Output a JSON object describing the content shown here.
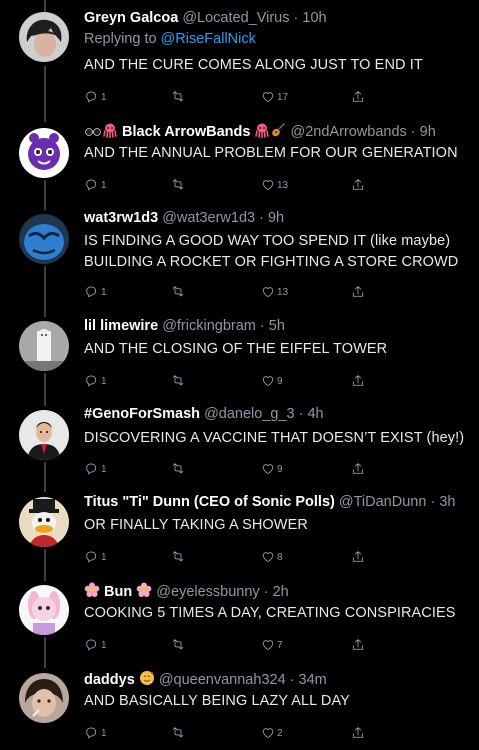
{
  "colors": {
    "background": "#000000",
    "text": "#e7e9ea",
    "muted": "#8b98a5",
    "link": "#1da1f2"
  },
  "tweets": [
    {
      "name": "Greyn Galcoa",
      "handle": "@Located_Virus",
      "time": "10h",
      "replying_prefix": "Replying to ",
      "replying_to": "@RiseFallNick",
      "lines": [
        "AND THE CURE COMES ALONG JUST TO END IT"
      ],
      "replies": "1",
      "retweets": "",
      "likes": "17",
      "avatar": "dark-hair-photo"
    },
    {
      "name": "Black ArrowBands",
      "handle": "@2ndArrowbands",
      "time": "9h",
      "lines": [
        "AND THE ANNUAL PROBLEM FOR OUR GENERATION"
      ],
      "replies": "1",
      "retweets": "",
      "likes": "13",
      "avatar": "purple-cartoon-cat",
      "emoji_prefix": [
        "sunglasses-emoji",
        "octopus-emoji"
      ],
      "emoji_suffix": [
        "octopus-emoji",
        "guitar-emoji"
      ]
    },
    {
      "name": "wat3rw1d3",
      "handle": "@wat3erw1d3",
      "time": "9h",
      "lines": [
        "IS FINDING A GOOD WAY TOO SPEND IT (like maybe)",
        "BUILDING A ROCKET OR FIGHTING A STORE CROWD"
      ],
      "replies": "1",
      "retweets": "",
      "likes": "13",
      "avatar": "blue-cartoon-character"
    },
    {
      "name": "lil limewire",
      "handle": "@frickingbram",
      "time": "5h",
      "lines": [
        "AND THE CLOSING OF THE EIFFEL TOWER"
      ],
      "replies": "1",
      "retweets": "",
      "likes": "9",
      "avatar": "white-figure-photo"
    },
    {
      "name": "#GenoForSmash",
      "handle": "@danelo_g_3",
      "time": "4h",
      "lines": [
        "DISCOVERING A VACCINE THAT DOESN’T EXIST (hey!)"
      ],
      "replies": "1",
      "retweets": "",
      "likes": "9",
      "avatar": "suited-man-photo"
    },
    {
      "name": "Titus \"Ti\" Dunn (CEO of Sonic Polls)",
      "handle": "@TiDanDunn",
      "time": "3h",
      "lines": [
        "OR FINALLY TAKING A SHOWER"
      ],
      "replies": "1",
      "retweets": "",
      "likes": "8",
      "avatar": "cartoon-duck"
    },
    {
      "name": "Bun",
      "handle": "@eyelessbunny",
      "time": "2h",
      "lines": [
        "COOKING 5 TIMES A DAY, CREATING CONSPIRACIES"
      ],
      "replies": "1",
      "retweets": "",
      "likes": "7",
      "avatar": "pink-bunny-character",
      "emoji_prefix": [
        "flower-emoji"
      ],
      "emoji_suffix": [
        "flower-emoji"
      ]
    },
    {
      "name": "daddys",
      "handle": "@queenvannah324",
      "time": "34m",
      "lines": [
        "AND BASICALLY BEING LAZY ALL DAY"
      ],
      "replies": "1",
      "retweets": "",
      "likes": "2",
      "avatar": "selfie-photo",
      "emoji_suffix": [
        "smiling-hearts-emoji"
      ]
    }
  ]
}
